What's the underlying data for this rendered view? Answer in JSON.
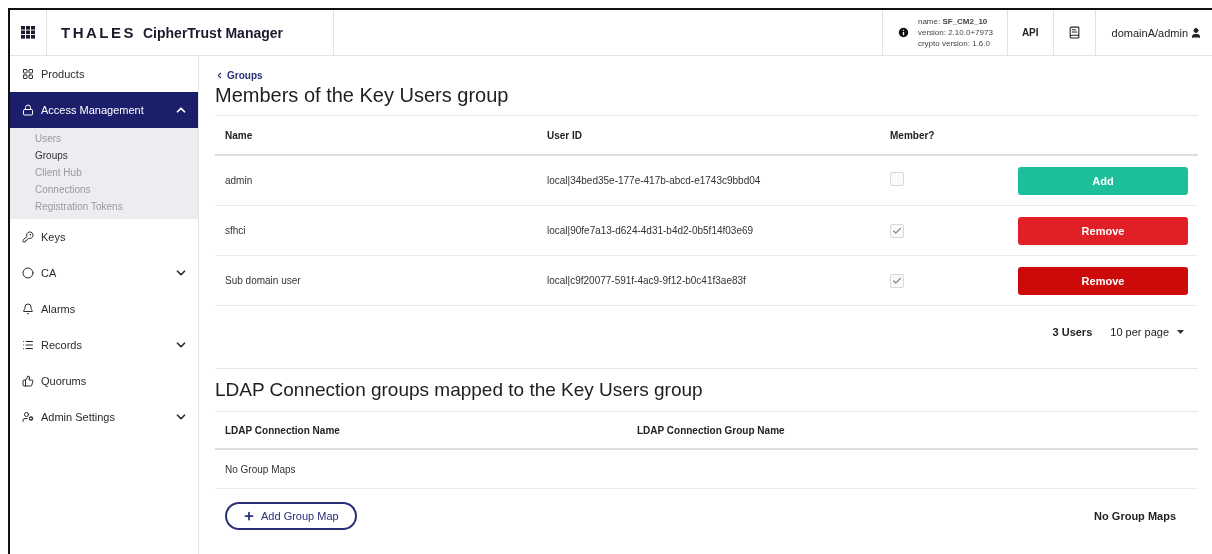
{
  "header": {
    "brand": "THALES",
    "product": "CipherTrust Manager",
    "info_lines": [
      "name: **SF_CM2_10**",
      "version: 2.10.0+7973",
      "crypto version: 1.6.0"
    ],
    "api_link": "API",
    "user": "domainA/admin"
  },
  "sidebar": {
    "items": [
      {
        "label": "Products",
        "kind": "link",
        "selected": false
      },
      {
        "label": "Access Management",
        "kind": "group",
        "selected": true,
        "expanded": true,
        "children": [
          {
            "label": "Users",
            "selected": false
          },
          {
            "label": "Groups",
            "selected": true
          },
          {
            "label": "Client Hub",
            "selected": false
          },
          {
            "label": "Connections",
            "selected": false
          },
          {
            "label": "Registration Tokens",
            "selected": false
          }
        ]
      },
      {
        "label": "Keys",
        "kind": "link",
        "selected": false
      },
      {
        "label": "CA",
        "kind": "group",
        "selected": false,
        "expanded": false
      },
      {
        "label": "Alarms",
        "kind": "link",
        "selected": false
      },
      {
        "label": "Records",
        "kind": "group",
        "selected": false,
        "expanded": false
      },
      {
        "label": "Quorums",
        "kind": "link",
        "selected": false
      },
      {
        "label": "Admin Settings",
        "kind": "group",
        "selected": false,
        "expanded": false
      }
    ]
  },
  "breadcrumb": "Groups",
  "members": {
    "title": "Members of the Key Users group",
    "columns": [
      "Name",
      "User ID",
      "Member?"
    ],
    "rows": [
      {
        "name": "admin",
        "user_id": "local|34bed35e-177e-417b-abcd-e1743c9bbd04",
        "member": false,
        "action": {
          "label": "Add",
          "kind": "add",
          "hovered": false
        }
      },
      {
        "name": "sfhci",
        "user_id": "local|90fe7a13-d624-4d31-b4d2-0b5f14f03e69",
        "member": true,
        "action": {
          "label": "Remove",
          "kind": "remove",
          "hovered": false
        }
      },
      {
        "name": "Sub domain user",
        "user_id": "local|c9f20077-591f-4ac9-9f12-b0c41f3ae83f",
        "member": true,
        "action": {
          "label": "Remove",
          "kind": "remove",
          "hovered": true
        }
      }
    ],
    "count": "3 Users",
    "per_page": "10 per page"
  },
  "ldap": {
    "title": "LDAP Connection groups mapped to the Key Users group",
    "columns": [
      "LDAP Connection Name",
      "LDAP Connection Group Name"
    ],
    "empty": "No Group Maps",
    "add_button": "Add Group Map",
    "footer_note": "No Group Maps"
  }
}
